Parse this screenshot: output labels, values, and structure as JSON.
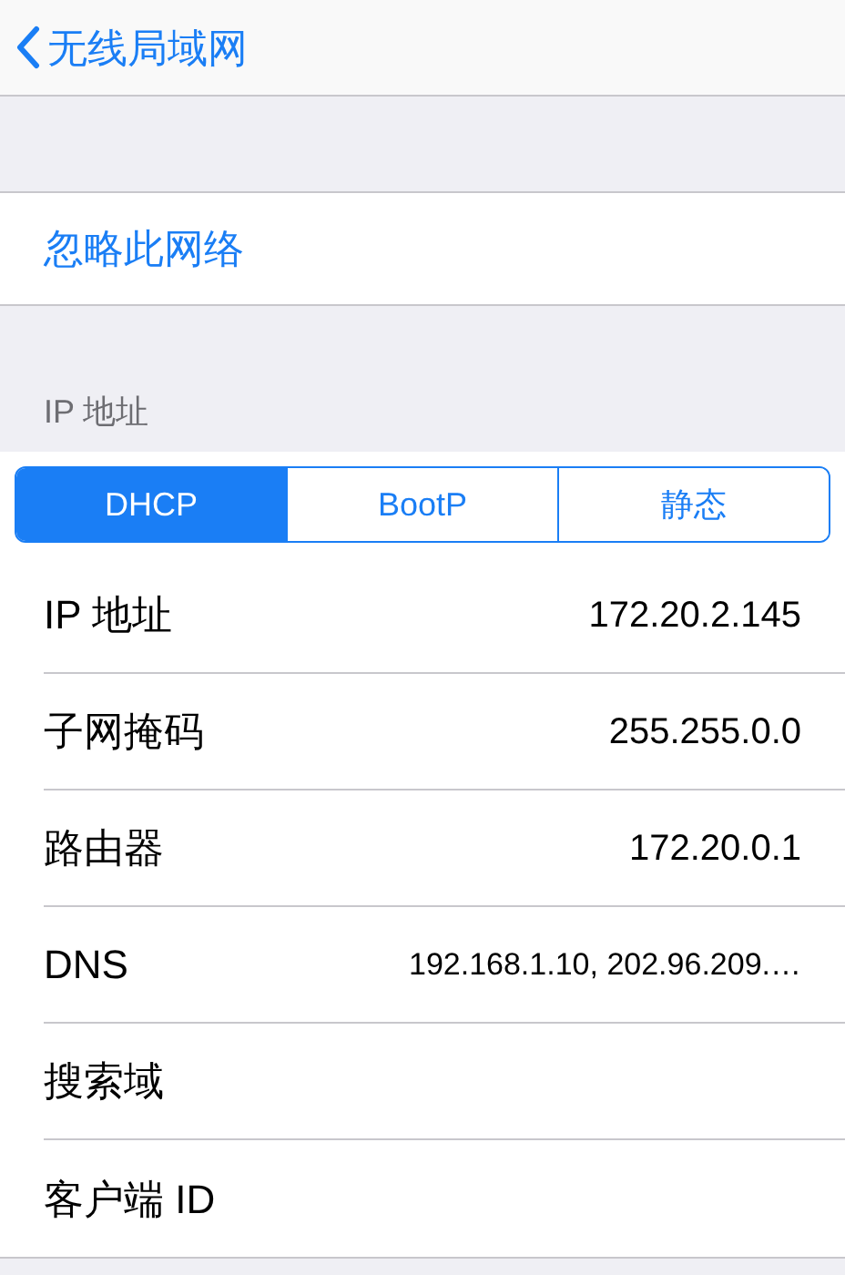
{
  "nav": {
    "back_label": "无线局域网"
  },
  "forget": {
    "label": "忽略此网络"
  },
  "section_header": "IP 地址",
  "segments": [
    {
      "label": "DHCP",
      "selected": true
    },
    {
      "label": "BootP",
      "selected": false
    },
    {
      "label": "静态",
      "selected": false
    }
  ],
  "rows": [
    {
      "label": "IP 地址",
      "value": "172.20.2.145",
      "kind": "normal"
    },
    {
      "label": "子网掩码",
      "value": "255.255.0.0",
      "kind": "normal"
    },
    {
      "label": "路由器",
      "value": "172.20.0.1",
      "kind": "normal"
    },
    {
      "label": "DNS",
      "value": "192.168.1.10, 202.96.209.…",
      "kind": "small"
    },
    {
      "label": "搜索域"
    },
    {
      "label": "客户端 ID"
    }
  ]
}
